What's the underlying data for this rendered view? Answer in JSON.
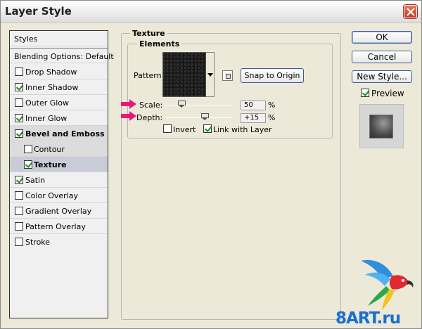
{
  "window": {
    "title": "Layer Style"
  },
  "styles_panel": {
    "items": [
      {
        "label": "Styles",
        "checkbox": false,
        "checked": false
      },
      {
        "label": "Blending Options: Default",
        "checkbox": false,
        "checked": false
      },
      {
        "label": "Drop Shadow",
        "checkbox": true,
        "checked": false
      },
      {
        "label": "Inner Shadow",
        "checkbox": true,
        "checked": true
      },
      {
        "label": "Outer Glow",
        "checkbox": true,
        "checked": false
      },
      {
        "label": "Inner Glow",
        "checkbox": true,
        "checked": true
      },
      {
        "label": "Bevel and Emboss",
        "checkbox": true,
        "checked": true,
        "bold": true,
        "selected_bg": true
      },
      {
        "label": "Contour",
        "checkbox": true,
        "checked": false,
        "sub": true
      },
      {
        "label": "Texture",
        "checkbox": true,
        "checked": true,
        "sub": true,
        "bold": true,
        "selected": true
      },
      {
        "label": "Satin",
        "checkbox": true,
        "checked": true
      },
      {
        "label": "Color Overlay",
        "checkbox": true,
        "checked": false
      },
      {
        "label": "Gradient Overlay",
        "checkbox": true,
        "checked": false
      },
      {
        "label": "Pattern Overlay",
        "checkbox": true,
        "checked": false
      },
      {
        "label": "Stroke",
        "checkbox": true,
        "checked": false
      }
    ]
  },
  "texture": {
    "group_title": "Texture",
    "elements_title": "Elements",
    "pattern_label": "Pattern:",
    "snap_button": "Snap to Origin",
    "scale_label": "Scale:",
    "scale_value": "50",
    "scale_unit": "%",
    "scale_slider_fraction": 0.5,
    "depth_label": "Depth:",
    "depth_value": "+15",
    "depth_unit": "%",
    "depth_slider_fraction": 0.575,
    "invert_label": "Invert",
    "invert_checked": false,
    "link_label": "Link with Layer",
    "link_checked": true
  },
  "buttons": {
    "ok": "OK",
    "cancel": "Cancel",
    "new_style": "New Style..."
  },
  "preview": {
    "label": "Preview",
    "checked": true
  },
  "watermark": {
    "text": "8ART.ru"
  },
  "colors": {
    "dialog_bg": "#ece9d8",
    "arrow_pink": "#e8187a",
    "check_green": "#1c8a1c",
    "button_border": "#3c5a9a",
    "logo_blue": "#1a6fd0"
  }
}
